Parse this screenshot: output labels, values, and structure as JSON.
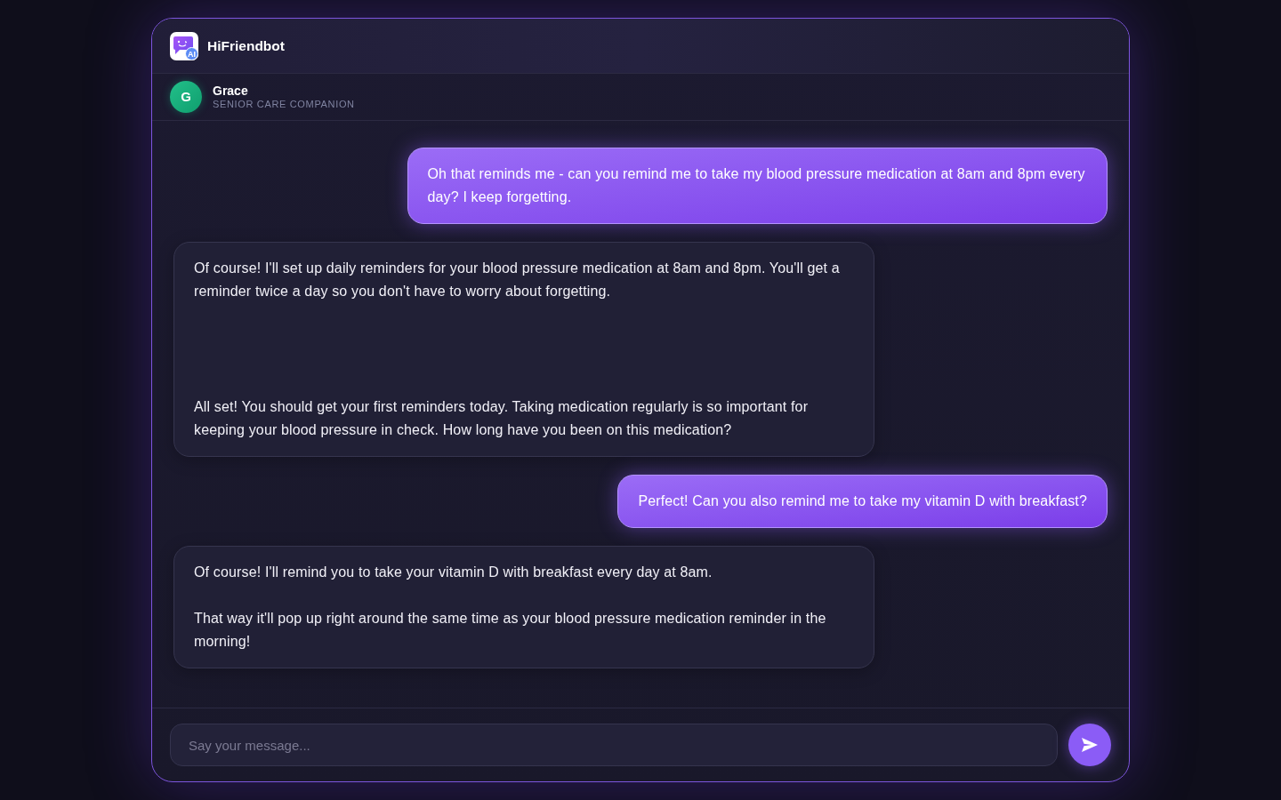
{
  "header": {
    "title": "HiFriendbot",
    "logo_badge": "AI"
  },
  "agent": {
    "initial": "G",
    "name": "Grace",
    "role": "SENIOR CARE COMPANION"
  },
  "messages": [
    {
      "kind": "user",
      "text": "Oh that reminds me - can you remind me to take my blood pressure medication at 8am and 8pm every day? I keep forgetting."
    },
    {
      "kind": "bot",
      "text": "Of course! I'll set up daily reminders for your blood pressure medication at 8am and 8pm. You'll get a reminder twice a day so you don't have to worry about forgetting.\n\n\n\n\nAll set! You should get your first reminders today. Taking medication regularly is so important for keeping your blood pressure in check. How long have you been on this medication?"
    },
    {
      "kind": "user",
      "text": "Perfect! Can you also remind me to take my vitamin D with breakfast?"
    },
    {
      "kind": "bot",
      "text": "Of course! I'll remind you to take your vitamin D with breakfast every day at 8am.\n\nThat way it'll pop up right around the same time as your blood pressure medication reminder in the morning!"
    }
  ],
  "composer": {
    "placeholder": "Say your message..."
  }
}
